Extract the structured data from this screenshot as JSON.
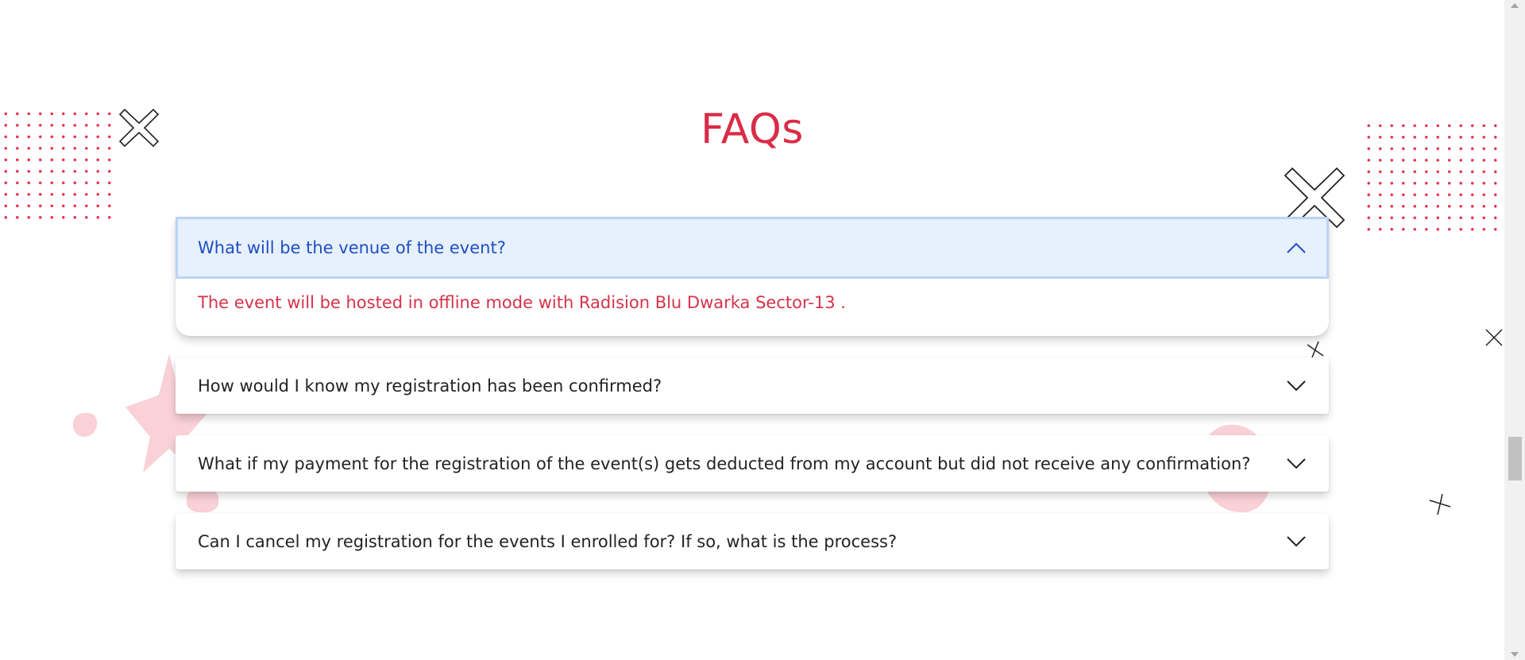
{
  "section": {
    "title": "FAQs"
  },
  "faqs": [
    {
      "question": "What will be the venue of the event?",
      "answer": "The event will be hosted in offline mode with Radision Blu Dwarka Sector-13 .",
      "expanded": true,
      "icon": "chevron-up-icon"
    },
    {
      "question": "How would I know my registration has been confirmed?",
      "expanded": false,
      "icon": "chevron-down-icon"
    },
    {
      "question": "What if my payment for the registration of the event(s) gets deducted from my account but did not receive any confirmation?",
      "expanded": false,
      "icon": "chevron-down-icon"
    },
    {
      "question": "Can I cancel my registration for the events I enrolled for? If so, what is the process?",
      "expanded": false,
      "icon": "chevron-down-icon"
    }
  ],
  "colors": {
    "accent": "#d92c47",
    "open_header_bg": "#e7f0fd",
    "open_question": "#1e4fc2",
    "dots": "#e8344e",
    "blob": "#f8c9d0"
  }
}
